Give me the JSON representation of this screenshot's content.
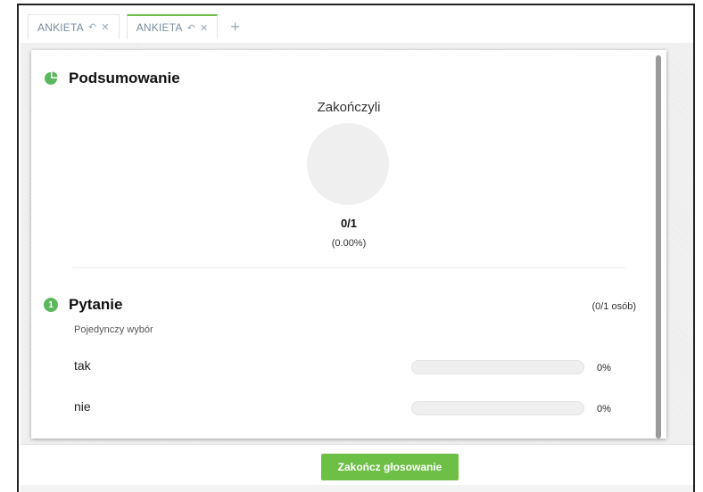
{
  "tabs": [
    {
      "label": "ANKIETA",
      "undo_icon": "undo-icon",
      "close_icon": "close-icon",
      "active": false
    },
    {
      "label": "ANKIETA",
      "undo_icon": "undo-icon",
      "close_icon": "close-icon",
      "active": true
    }
  ],
  "add_tab_glyph": "+",
  "summary": {
    "title": "Podsumowanie",
    "icon": "pie-chart-icon",
    "finished_label": "Zakończyli",
    "ratio": "0/1",
    "percent": "(0.00%)",
    "finished_fraction": 0
  },
  "question": {
    "number": "1",
    "title": "Pytanie",
    "count": "(0/1 osób)",
    "type": "Pojedynczy wybór",
    "answers": [
      {
        "label": "tak",
        "percent": "0%",
        "fraction": 0
      },
      {
        "label": "nie",
        "percent": "0%",
        "fraction": 0
      }
    ]
  },
  "footer": {
    "finish_button": "Zakończ głosowanie"
  },
  "colors": {
    "accent": "#6dbf45",
    "badge": "#5cb85c",
    "tab_text": "#7a8ca0"
  }
}
